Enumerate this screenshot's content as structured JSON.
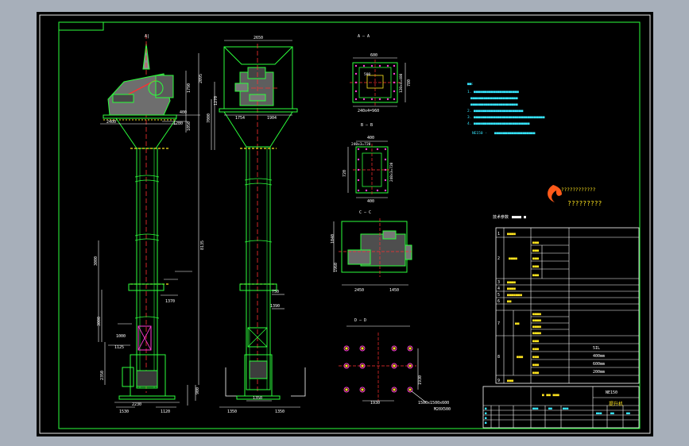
{
  "colors": {
    "background": "#a7afba",
    "sheet": "#000000",
    "frame": "#e8e8e8",
    "outline": "#2bff3b",
    "dimension": "#ffffff",
    "centerline": "#ff3030",
    "fill": "#8f8f8f",
    "yellow": "#ffe51f",
    "magenta": "#ff3bd6",
    "cyan": "#37e6ff",
    "logo": "#ff5a1a"
  },
  "labels": {
    "top_dim_width": "2650",
    "top_arrow_a": "A|",
    "dim_2095": "2095",
    "dim_8135": "8135",
    "dim_1790": "1790",
    "dim_1050": "1050",
    "dim_400": "400",
    "dim_1280": "1280",
    "dim_2400": "2400",
    "dim_3000_a": "3000",
    "dim_3000_b": "3000",
    "dim_1370": "1370",
    "dim_1125": "1125",
    "dim_2350": "2350",
    "dim_2230": "2230",
    "dim_1530": "1530",
    "dim_1120": "1120",
    "dim_900": "900",
    "dim_1000": "1000",
    "dim_1390": "1390",
    "dim_1350_a": "1350",
    "dim_1350_b": "1350",
    "dim_750": "750",
    "dim_1270": "1270",
    "dim_1754": "1754",
    "dim_1904": "1904",
    "dim_7000": "7000",
    "dim_500": "500",
    "dim_600_a": "600",
    "dim_600_b": "600",
    "dim_120x4": "120x4=480",
    "dim_780": "780",
    "dim_240x4": "240x4=960",
    "dim_400_a": "400",
    "dim_400_b": "400",
    "dim_240x3": "240x3=720",
    "dim_720": "720",
    "dim_2450": "2450",
    "dim_1450": "1450",
    "dim_1040": "1040",
    "dim_1960": "1960",
    "dim_1930": "1930",
    "dim_ab": "1500x1500x600",
    "dim_bolt": "M20X500",
    "note_1": "1. ",
    "note_2": "2. ",
    "note_3": "3. ",
    "note_4": "4. ",
    "note_5": "NE150 - ",
    "logo_text": "????????????",
    "logo_subtitle": "?????????",
    "table_title": "技术参数",
    "param_unit": "5IL",
    "param_400": "400mm",
    "param_600": "600mm",
    "param_200": "200mm",
    "title_code": "NE150",
    "title_name": "提升机"
  },
  "table": {
    "row_numbers": [
      "1",
      "2",
      "3",
      "4",
      "5",
      "6",
      "7",
      "8",
      "9"
    ]
  }
}
